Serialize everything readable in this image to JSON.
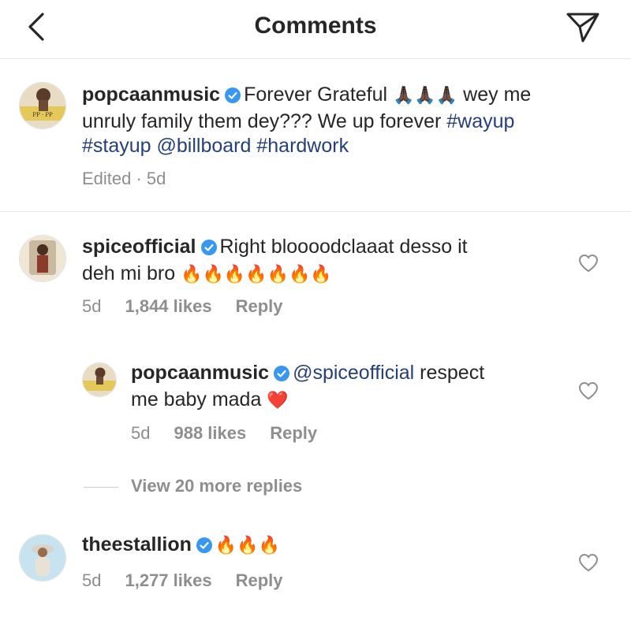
{
  "header": {
    "title": "Comments"
  },
  "caption": {
    "username": "popcaanmusic",
    "text_before": "Forever Grateful",
    "emoji": "🙏🏿🙏🏿🙏🏿",
    "text_line1_end": "wey me",
    "text_line2": "unruly family them dey??? We up forever",
    "hashtag_wayup": "#wayup",
    "hashtag_stayup": "#stayup",
    "mention_billboard": "@billboard",
    "hashtag_hardwork": "#hardwork",
    "meta": "Edited · 5d",
    "avatar_text": "PP · PP"
  },
  "comments": [
    {
      "username": "spiceofficial",
      "text_line1": "Right bloooodclaaat desso it",
      "text_line2": "deh mi bro",
      "emoji": "🔥🔥🔥🔥🔥🔥🔥",
      "time": "5d",
      "likes": "1,844 likes",
      "reply": "Reply"
    },
    {
      "username": "popcaanmusic",
      "mention": "@spiceofficial",
      "text_line1": "respect",
      "text_line2": "me baby mada",
      "emoji": "❤️",
      "time": "5d",
      "likes": "988 likes",
      "reply": "Reply"
    },
    {
      "username": "theestallion",
      "emoji": "🔥🔥🔥",
      "time": "5d",
      "likes": "1,277 likes",
      "reply": "Reply"
    }
  ],
  "view_more": "View 20 more replies",
  "colors": {
    "link": "#243f7a",
    "muted": "#8e8e8e",
    "verified": "#3897f0",
    "text": "#262626"
  }
}
